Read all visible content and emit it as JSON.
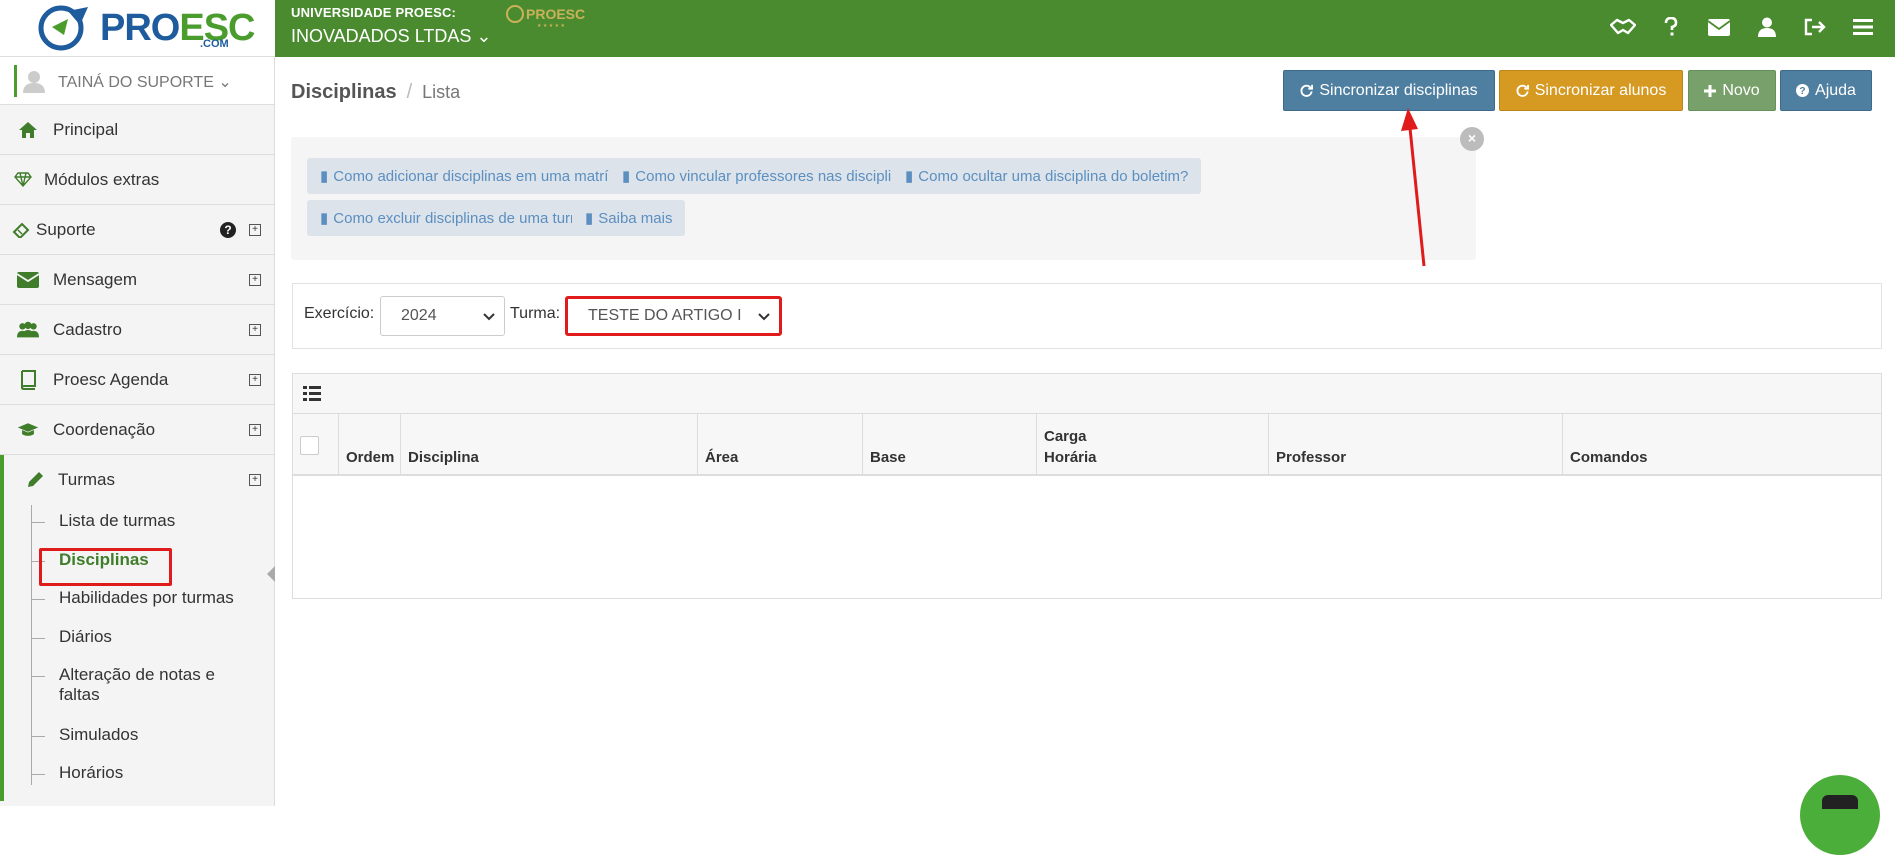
{
  "brand": {
    "logo_pro": "PRO",
    "logo_esc": "ESC",
    "logo_com": ".COM"
  },
  "header": {
    "org_top": "UNIVERSIDADE PROESC:",
    "org_name": "INOVADADOS LTDAS ⌄",
    "icons": [
      "handshake-icon",
      "question-icon",
      "envelope-icon",
      "user-icon",
      "sign-out-icon",
      "menu-icon"
    ]
  },
  "sidebar": {
    "user": "TAINÁ DO SUPORTE ⌄",
    "items": [
      {
        "label": "Principal",
        "icon": "home-icon"
      },
      {
        "label": "Módulos extras",
        "icon": "diamond-icon"
      },
      {
        "label": "Suporte",
        "icon": "ticket-icon"
      },
      {
        "label": "Mensagem",
        "icon": "envelope-icon"
      },
      {
        "label": "Cadastro",
        "icon": "users-icon"
      },
      {
        "label": "Proesc Agenda",
        "icon": "book-icon"
      },
      {
        "label": "Coordenação",
        "icon": "graduation-cap-icon"
      },
      {
        "label": "Turmas",
        "icon": "pencil-icon"
      }
    ],
    "turmas_sub": [
      "Lista de turmas",
      "Disciplinas",
      "Habilidades por turmas",
      "Diários",
      "Alteração de notas e faltas",
      "Simulados",
      "Horários"
    ],
    "expand_symbol": "⊞",
    "help_symbol": "?"
  },
  "page": {
    "title": "Disciplinas",
    "separator": "/",
    "subtitle": "Lista",
    "buttons": {
      "sync_disciplinas": "Sincronizar disciplinas",
      "sync_alunos": "Sincronizar alunos",
      "novo": "Novo",
      "ajuda": "Ajuda"
    },
    "help_close": "×",
    "help_links": [
      "Como adicionar disciplinas em uma matrícula?",
      "Como vincular professores nas disciplinas?",
      "Como ocultar uma disciplina do boletim?",
      "Como excluir disciplinas de uma turma?",
      "Saiba mais"
    ]
  },
  "filters": {
    "exercicio_label": "Exercício:",
    "exercicio_value": "2024",
    "turma_label": "Turma:",
    "turma_value": "TESTE DO ARTIGO I"
  },
  "table": {
    "columns": [
      "Ordem",
      "Disciplina",
      "Área",
      "Base",
      "Carga Horária",
      "Professor",
      "Comandos"
    ],
    "rows": []
  },
  "colors": {
    "header_green": "#4a8b2f",
    "annotation_red": "#e01b1b"
  }
}
